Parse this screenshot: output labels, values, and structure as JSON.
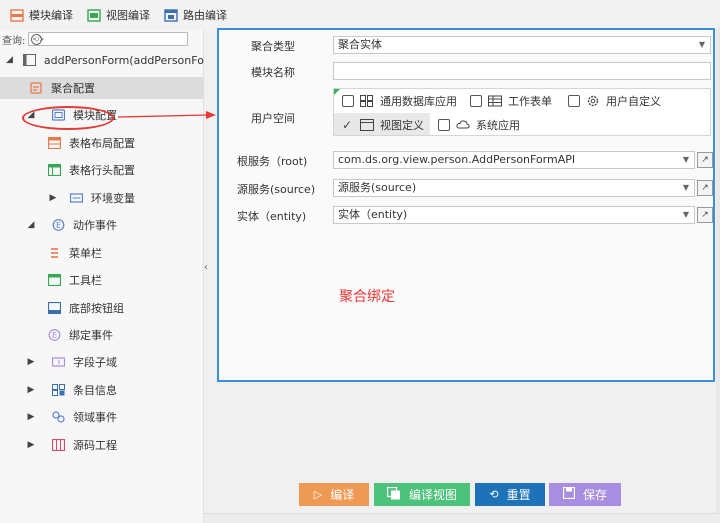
{
  "toolbar": {
    "items": [
      {
        "label": "模块编译",
        "icon": "module-compile-icon",
        "color": "#e8794a"
      },
      {
        "label": "视图编译",
        "icon": "view-compile-icon",
        "color": "#35a853"
      },
      {
        "label": "路由编译",
        "icon": "route-compile-icon",
        "color": "#3a6fb0"
      }
    ]
  },
  "search": {
    "label": "查询:",
    "icon": "search-icon"
  },
  "tree": {
    "root": "addPersonForm(addPersonForm",
    "items": [
      {
        "label": "聚合配置",
        "icon": "aggregate-config-icon"
      },
      {
        "label": "模块配置",
        "icon": "module-config-icon"
      },
      {
        "label": "表格布局配置",
        "icon": "table-layout-icon"
      },
      {
        "label": "表格行头配置",
        "icon": "table-header-icon"
      },
      {
        "label": "环境变量",
        "icon": "env-var-icon"
      },
      {
        "label": "动作事件",
        "icon": "action-event-icon"
      },
      {
        "label": "菜单栏",
        "icon": "menubar-icon"
      },
      {
        "label": "工具栏",
        "icon": "toolbar-icon"
      },
      {
        "label": "底部按钮组",
        "icon": "bottom-buttons-icon"
      },
      {
        "label": "绑定事件",
        "icon": "bind-event-icon"
      },
      {
        "label": "字段子域",
        "icon": "field-subdomain-icon"
      },
      {
        "label": "条目信息",
        "icon": "item-info-icon"
      },
      {
        "label": "领域事件",
        "icon": "domain-event-icon"
      },
      {
        "label": "源码工程",
        "icon": "source-project-icon"
      }
    ]
  },
  "form": {
    "aggregate_type": {
      "label": "聚合类型",
      "value": "聚合实体"
    },
    "module_name": {
      "label": "模块名称",
      "value": ""
    },
    "user_space": {
      "label": "用户空间",
      "options": [
        {
          "label": "通用数据库应用",
          "checked": false,
          "icon": "grid-icon"
        },
        {
          "label": "工作表单",
          "checked": false,
          "icon": "table-icon"
        },
        {
          "label": "用户自定义",
          "checked": false,
          "icon": "gear-icon"
        },
        {
          "label": "视图定义",
          "checked": true,
          "icon": "window-icon"
        },
        {
          "label": "系统应用",
          "checked": false,
          "icon": "cloud-icon"
        }
      ]
    },
    "root_service": {
      "label": "根服务（root)",
      "value": "com.ds.org.view.person.AddPersonFormAPI"
    },
    "source_service": {
      "label": "源服务(source)",
      "value": "源服务(source)"
    },
    "entity": {
      "label": "实体（entity)",
      "value": "实体（entity)"
    },
    "annotation": "聚合绑定"
  },
  "buttons": [
    {
      "label": "编译",
      "icon": "play-icon",
      "color": "#ee9a55"
    },
    {
      "label": "编译视图",
      "icon": "copy-icon",
      "color": "#4cc27a"
    },
    {
      "label": "重置",
      "icon": "reset-icon",
      "color": "#1d72b8"
    },
    {
      "label": "保存",
      "icon": "save-icon",
      "color": "#a88ee0"
    }
  ]
}
